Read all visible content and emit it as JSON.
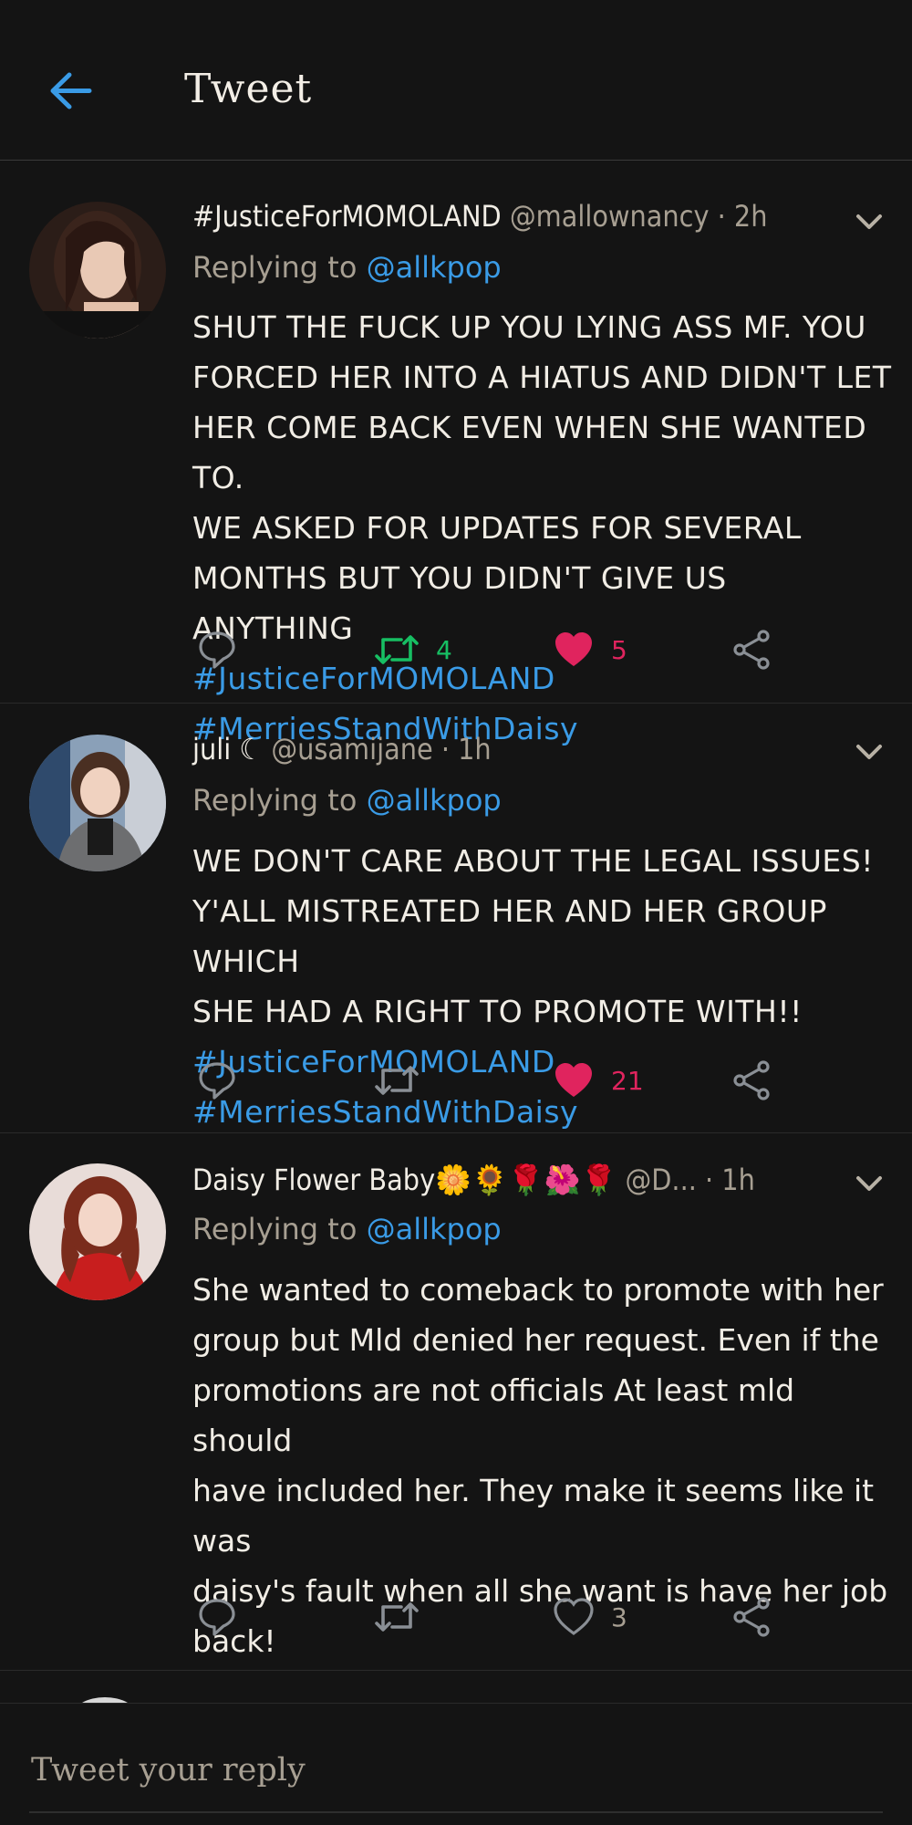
{
  "header": {
    "title": "Tweet"
  },
  "tweets": [
    {
      "name": "#JusticeForMOMOLAND",
      "handle": "@mallownancy",
      "time": "· 2h",
      "replying_prefix": "Replying to ",
      "replying_to": "@allkpop",
      "lines": [
        "SHUT THE FUCK UP YOU LYING ASS MF. YOU",
        "FORCED HER INTO A HIATUS AND DIDN'T LET",
        "HER COME BACK EVEN WHEN SHE WANTED TO.",
        "WE ASKED FOR UPDATES FOR SEVERAL",
        "MONTHS BUT YOU DIDN'T GIVE US ANYTHING"
      ],
      "hashtag1": "#JusticeForMOMOLAND",
      "hashtag2": "#MerriesStandWithDaisy",
      "retweets": "4",
      "likes": "5",
      "liked": true,
      "retweeted": true
    },
    {
      "name": "juli ☾",
      "handle": "@usamijane",
      "time": "· 1h",
      "replying_prefix": "Replying to ",
      "replying_to": "@allkpop",
      "lines": [
        "WE DON'T CARE ABOUT THE LEGAL ISSUES!",
        "Y'ALL MISTREATED HER AND HER GROUP WHICH",
        "SHE HAD A RIGHT TO PROMOTE WITH!!"
      ],
      "hashtag1": "#JusticeForMOMOLAND",
      "hashtag2": "#MerriesStandWithDaisy",
      "retweets": "",
      "likes": "21",
      "liked": true,
      "retweeted": false
    },
    {
      "name": "Daisy Flower Baby🌼🌻🌹🌺🌹",
      "handle": "@D...",
      "time": "· 1h",
      "replying_prefix": "Replying to ",
      "replying_to": "@allkpop",
      "lines": [
        "She wanted to comeback to promote with her",
        "group but Mld denied her request. Even if the",
        "promotions are not officials At least mld should",
        "have included her. They make it seems like it was",
        "daisy's fault when all she want is have her job",
        "back!"
      ],
      "retweets": "",
      "likes": "3",
      "liked": false,
      "retweeted": false
    }
  ],
  "composer": {
    "placeholder": "Tweet your reply"
  },
  "colors": {
    "accent": "#3a9be6",
    "like": "#e0245e",
    "retweet": "#17bf63",
    "muted": "#a79f92",
    "background": "#141414"
  }
}
